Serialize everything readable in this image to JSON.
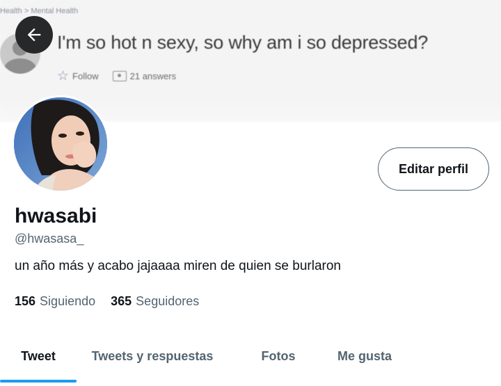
{
  "banner": {
    "breadcrumb": "Health > Mental Health",
    "question": "I'm so hot n sexy, so why am i so depressed?",
    "follow_label": "Follow",
    "answers_label": "21 answers"
  },
  "header": {
    "back_icon": "arrow-left-icon"
  },
  "profile": {
    "edit_label": "Editar perfil",
    "display_name": "hwasabi",
    "username": "@hwasasa_",
    "bio": "un año más y acabo jajaaaa miren de quien se burlaron",
    "following_count": "156",
    "following_label": "Siguiendo",
    "followers_count": "365",
    "followers_label": "Seguidores"
  },
  "tabs": [
    {
      "label": "Tweet",
      "active": true
    },
    {
      "label": "Tweets y respuestas",
      "active": false
    },
    {
      "label": "Fotos",
      "active": false
    },
    {
      "label": "Me gusta",
      "active": false
    }
  ],
  "colors": {
    "accent": "#1d9bf0",
    "text_primary": "#0f1419",
    "text_secondary": "#536471"
  }
}
